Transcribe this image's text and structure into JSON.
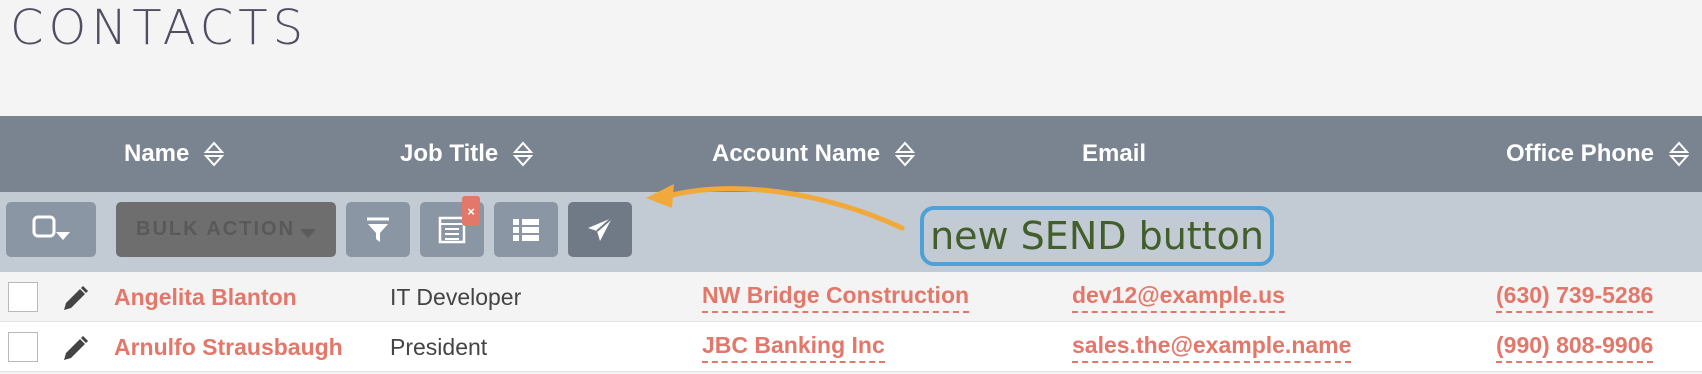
{
  "page": {
    "title": "CONTACTS"
  },
  "table": {
    "columns": [
      {
        "label": "Name",
        "sortable": true
      },
      {
        "label": "Job Title",
        "sortable": true
      },
      {
        "label": "Account Name",
        "sortable": true
      },
      {
        "label": "Email",
        "sortable": false
      },
      {
        "label": "Office Phone",
        "sortable": true
      }
    ],
    "rows": [
      {
        "name": "Angelita Blanton",
        "job_title": "IT Developer",
        "account": "NW Bridge Construction",
        "email": "dev12@example.us",
        "phone": "(630) 739-5286"
      },
      {
        "name": "Arnulfo Strausbaugh",
        "job_title": "President",
        "account": "JBC Banking Inc",
        "email": "sales.the@example.name",
        "phone": "(990) 808-9906"
      }
    ]
  },
  "toolbar": {
    "select_icon": "checkbox-dropdown-icon",
    "bulk_action_label": "BULK ACTION",
    "filter_icon": "funnel-icon",
    "columns_icon": "column-chooser-icon",
    "columns_badge": "×",
    "list_icon": "list-view-icon",
    "send_icon": "paper-plane-icon"
  },
  "annotation": {
    "text": "new SEND button",
    "border_color": "#4fa0d6",
    "arrow_color": "#f2a93b"
  },
  "colors": {
    "header_bg": "#7a8490",
    "toolbar_bg": "#c2cad3",
    "link": "#e2776a",
    "title": "#534d64"
  }
}
